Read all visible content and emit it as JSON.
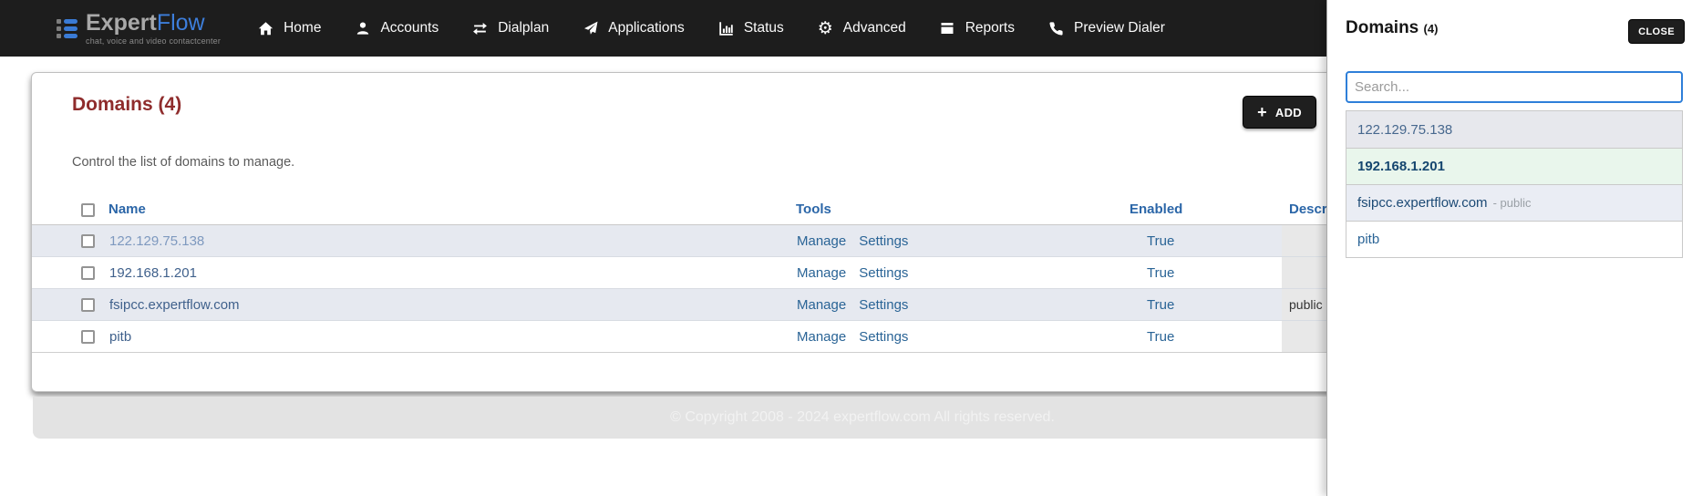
{
  "brand": {
    "name_primary": "Expert",
    "name_secondary": "Flow",
    "tagline": "chat, voice and video contactcenter"
  },
  "nav": {
    "items": [
      {
        "label": "Home",
        "icon": "home-icon"
      },
      {
        "label": "Accounts",
        "icon": "user-icon"
      },
      {
        "label": "Dialplan",
        "icon": "swap-arrows-icon"
      },
      {
        "label": "Applications",
        "icon": "paper-plane-icon"
      },
      {
        "label": "Status",
        "icon": "bar-chart-icon"
      },
      {
        "label": "Advanced",
        "icon": "gear-icon"
      },
      {
        "label": "Reports",
        "icon": "book-icon"
      },
      {
        "label": "Preview Dialer",
        "icon": "phone-icon"
      }
    ]
  },
  "page": {
    "title": "Domains (4)",
    "subtitle": "Control the list of domains to manage.",
    "add_button_icon": "+",
    "add_button": "ADD",
    "table": {
      "headers": [
        "Name",
        "Tools",
        "Enabled",
        "Description"
      ],
      "rows": [
        {
          "name": "122.129.75.138",
          "tools": [
            "Manage",
            "Settings"
          ],
          "enabled": "True",
          "description": ""
        },
        {
          "name": "192.168.1.201",
          "tools": [
            "Manage",
            "Settings"
          ],
          "enabled": "True",
          "description": ""
        },
        {
          "name": "fsipcc.expertflow.com",
          "tools": [
            "Manage",
            "Settings"
          ],
          "enabled": "True",
          "description": "public"
        },
        {
          "name": "pitb",
          "tools": [
            "Manage",
            "Settings"
          ],
          "enabled": "True",
          "description": ""
        }
      ]
    },
    "footer": "© Copyright 2008 - 2024 expertflow.com All rights reserved."
  },
  "panel": {
    "title": "Domains",
    "count": "(4)",
    "close_button": "CLOSE",
    "search_placeholder": "Search...",
    "items": [
      {
        "label": "122.129.75.138",
        "suffix": ""
      },
      {
        "label": "192.168.1.201",
        "suffix": ""
      },
      {
        "label": "fsipcc.expertflow.com",
        "suffix": "- public"
      },
      {
        "label": "pitb",
        "suffix": ""
      }
    ]
  },
  "colors": {
    "navbar_bg": "#1d1d1d",
    "brand_blue": "#3d7edb",
    "title_red": "#8f2c2c",
    "link_blue": "#2a6496",
    "header_blue": "#2b66a8",
    "stripe_bg": "#e6e9f0",
    "selected_green_bg": "#e9f6ec",
    "search_focus_border": "#2e7fd9"
  }
}
